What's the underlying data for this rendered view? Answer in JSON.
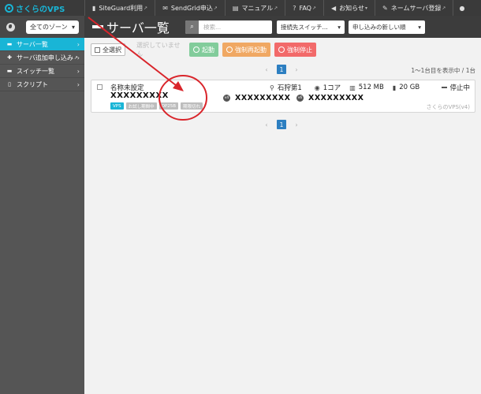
{
  "app": {
    "logo": "さくらのVPS"
  },
  "topnav": {
    "items": [
      {
        "label": "SiteGuard利用",
        "icon": "shield-icon"
      },
      {
        "label": "SendGrid申込",
        "icon": "envelope-icon"
      },
      {
        "label": "マニュアル",
        "icon": "book-icon"
      },
      {
        "label": "FAQ",
        "icon": "question-icon"
      },
      {
        "label": "お知らせ",
        "icon": "bullhorn-icon"
      },
      {
        "label": "ネームサーバ登録",
        "icon": "edit-icon"
      }
    ],
    "user_icon": "user-icon"
  },
  "sidebar": {
    "zone_select": "全てのゾーン",
    "items": [
      {
        "label": "サーバ一覧",
        "icon": "list-icon",
        "active": true
      },
      {
        "label": "サーバ追加申し込み",
        "icon": "plus-icon",
        "active": false
      },
      {
        "label": "スイッチ一覧",
        "icon": "switch-icon",
        "active": false
      },
      {
        "label": "スクリプト",
        "icon": "file-icon",
        "active": false
      }
    ]
  },
  "header": {
    "title": "サーバ一覧",
    "search_placeholder": "検索...",
    "switch_select": "接続先スイッチ...",
    "sort_select": "申し込みの新しい順"
  },
  "toolbar": {
    "select_all": "全選択",
    "no_selection": "選択していません",
    "start": "起動",
    "force_restart": "強制再起動",
    "force_stop": "強制停止"
  },
  "pagination": {
    "current": "1",
    "range_text": "1〜1台目を表示中 / 1台"
  },
  "server": {
    "name": "名称未設定",
    "id": "XXXXXXXXX",
    "ipv4_badge": "v4",
    "ipv4": "XXXXXXXXX",
    "ipv6_badge": "v6",
    "ipv6": "XXXXXXXXX",
    "location": "石狩第1",
    "cores": "1コア",
    "memory": "512 MB",
    "disk": "20 GB",
    "status": "停止中",
    "tags": [
      "VPS",
      "お試し期間中",
      "OP25B",
      "期限切れ"
    ],
    "plan": "さくらのVPS(v4)"
  },
  "annotation": {
    "color": "#d9252b"
  }
}
